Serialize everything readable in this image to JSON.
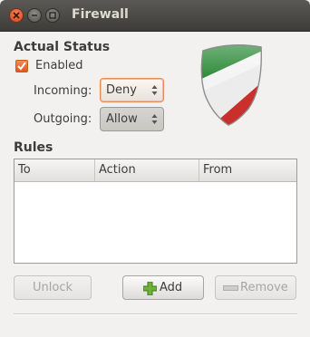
{
  "window": {
    "title": "Firewall"
  },
  "status": {
    "section_title": "Actual Status",
    "enabled_label": "Enabled",
    "enabled_checked": true,
    "incoming_label": "Incoming:",
    "incoming_value": "Deny",
    "outgoing_label": "Outgoing:",
    "outgoing_value": "Allow"
  },
  "rules": {
    "section_title": "Rules",
    "columns": [
      "To",
      "Action",
      "From"
    ],
    "rows": []
  },
  "buttons": {
    "unlock": "Unlock",
    "add": "Add",
    "remove": "Remove"
  },
  "icons": {
    "shield": "shield-icon",
    "add": "plus-icon",
    "remove": "minus-icon"
  },
  "colors": {
    "accent": "#e0581e",
    "titlebar": "#3d3c38",
    "shield_green": "#2e8b3a",
    "shield_red": "#c9302c"
  }
}
